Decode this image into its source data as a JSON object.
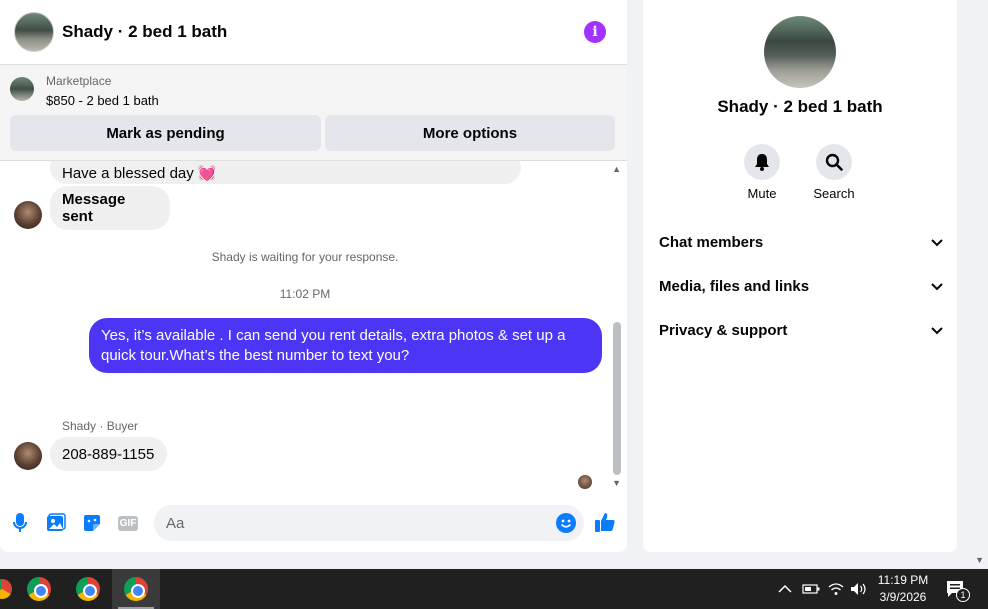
{
  "chat": {
    "title": "Shady · 2 bed 1 bath",
    "info_icon_glyph": "i"
  },
  "marketplace": {
    "label": "Marketplace",
    "listing": "$850 - 2 bed 1 bath",
    "mark_pending_label": "Mark as pending",
    "more_options_label": "More options"
  },
  "messages": {
    "partial_message": "Have a blessed day 💓",
    "message_sent": "Message sent",
    "waiting_notice": "Shady is waiting for your response.",
    "timestamp": "11:02 PM",
    "outgoing": "Yes, it’s available .  I can send you rent details, extra photos & set up a quick tour.What’s the best number to text you?",
    "sender_label": "Shady · Buyer",
    "incoming_phone": "208-889-1155"
  },
  "composer": {
    "placeholder": "Aa",
    "gif_label": "GIF",
    "icons": [
      "microphone-icon",
      "photo-icon",
      "sticker-icon",
      "gif-icon",
      "emoji-icon",
      "thumbs-up-icon"
    ],
    "accent": "#0a7cff"
  },
  "sidebar": {
    "title": "Shady · 2 bed 1 bath",
    "mute_label": "Mute",
    "search_label": "Search",
    "sections": [
      "Chat members",
      "Media, files and links",
      "Privacy & support"
    ]
  },
  "taskbar": {
    "time": "11:19 PM",
    "date": "3/9/2026",
    "notification_count": "1",
    "apps": [
      "chrome-icon",
      "chrome-icon",
      "chrome-icon"
    ]
  },
  "colors": {
    "outgoing_bubble": "#4d35f5",
    "info_button": "#a033ff",
    "like_button": "#0a7cff"
  }
}
